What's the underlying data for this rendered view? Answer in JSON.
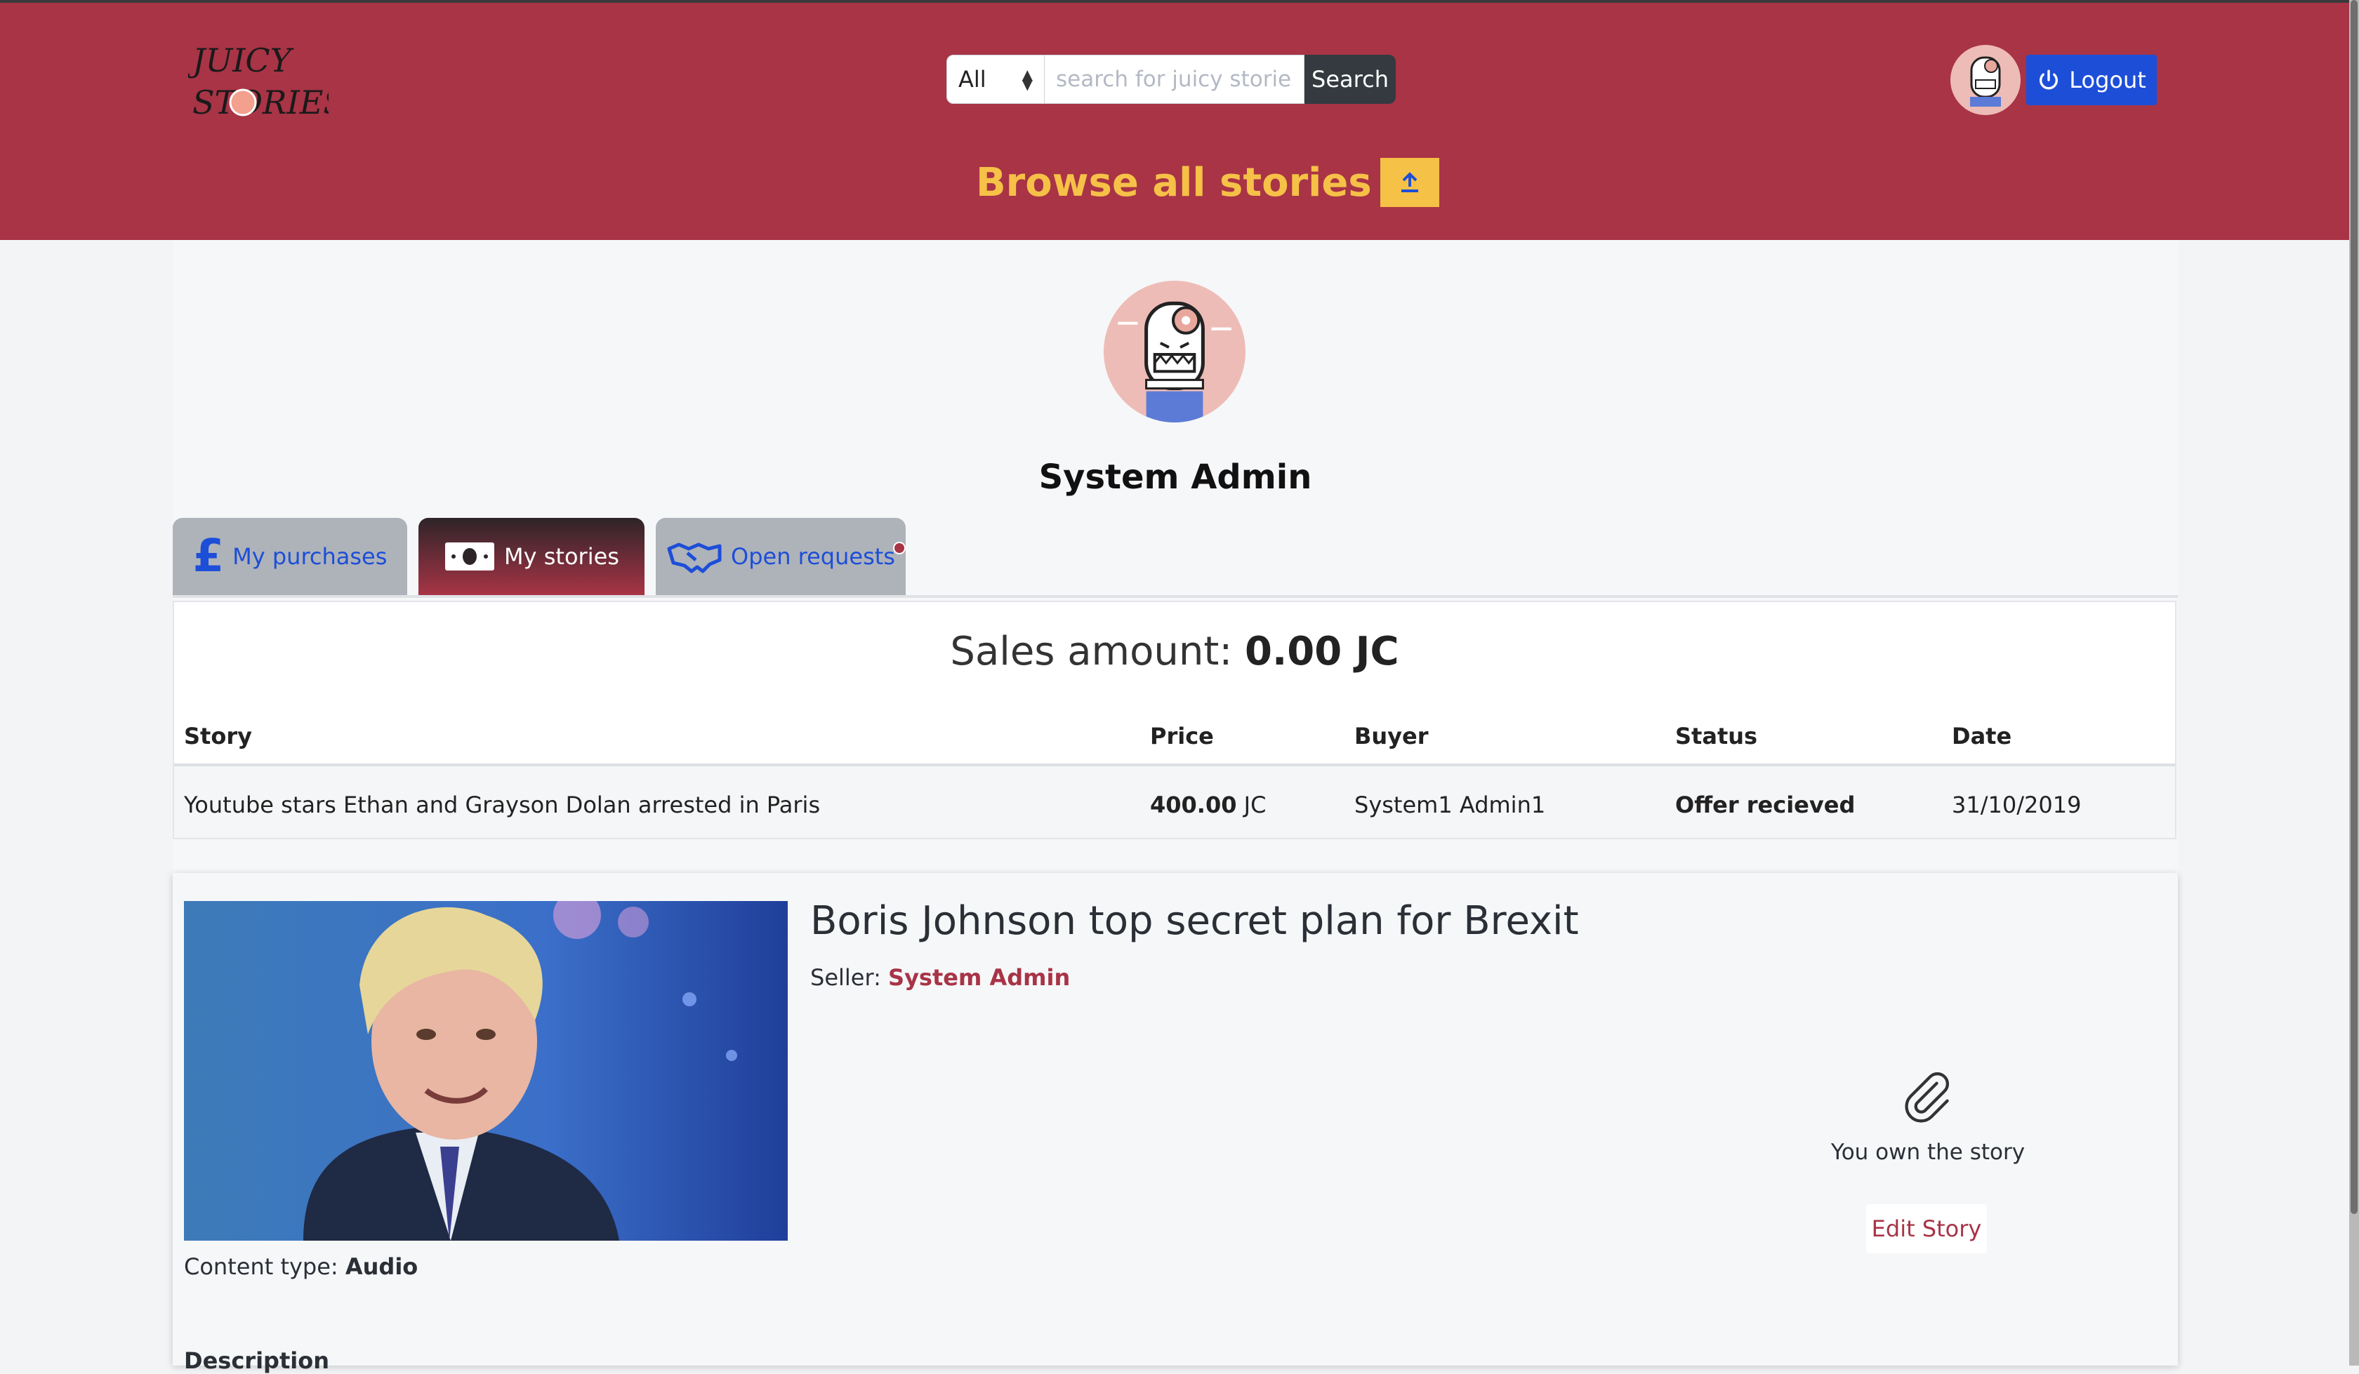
{
  "header": {
    "logo": {
      "text_line1": "JUICY",
      "text_line2": "STORIES"
    },
    "search": {
      "category_selected": "All",
      "placeholder": "search for juicy stories",
      "button_label": "Search"
    },
    "logout_label": "Logout",
    "browse_label": "Browse all stories"
  },
  "profile": {
    "name": "System Admin"
  },
  "tabs": [
    {
      "label": "My purchases",
      "icon": "pound-icon",
      "active": false
    },
    {
      "label": "My stories",
      "icon": "banknote-icon",
      "active": true
    },
    {
      "label": "Open requests",
      "icon": "handshake-icon",
      "active": false,
      "notification_dot": true
    }
  ],
  "sales": {
    "label": "Sales amount:",
    "amount": "0.00 JC",
    "columns": [
      "Story",
      "Price",
      "Buyer",
      "Status",
      "Date"
    ],
    "rows": [
      {
        "story": "Youtube stars Ethan and Grayson Dolan arrested in Paris",
        "price": "400.00",
        "currency": "JC",
        "buyer": "System1 Admin1",
        "status": "Offer recieved",
        "date": "31/10/2019"
      }
    ]
  },
  "story_card": {
    "title": "Boris Johnson top secret plan for Brexit",
    "seller_label": "Seller:",
    "seller_name": "System Admin",
    "content_type_label": "Content type:",
    "content_type": "Audio",
    "description_label": "Description",
    "own_label": "You own the story",
    "edit_label": "Edit Story"
  },
  "colors": {
    "brand": "#a83446",
    "accent_yellow": "#f6c147",
    "link_blue": "#1d4ed8",
    "dark": "#343a40"
  }
}
